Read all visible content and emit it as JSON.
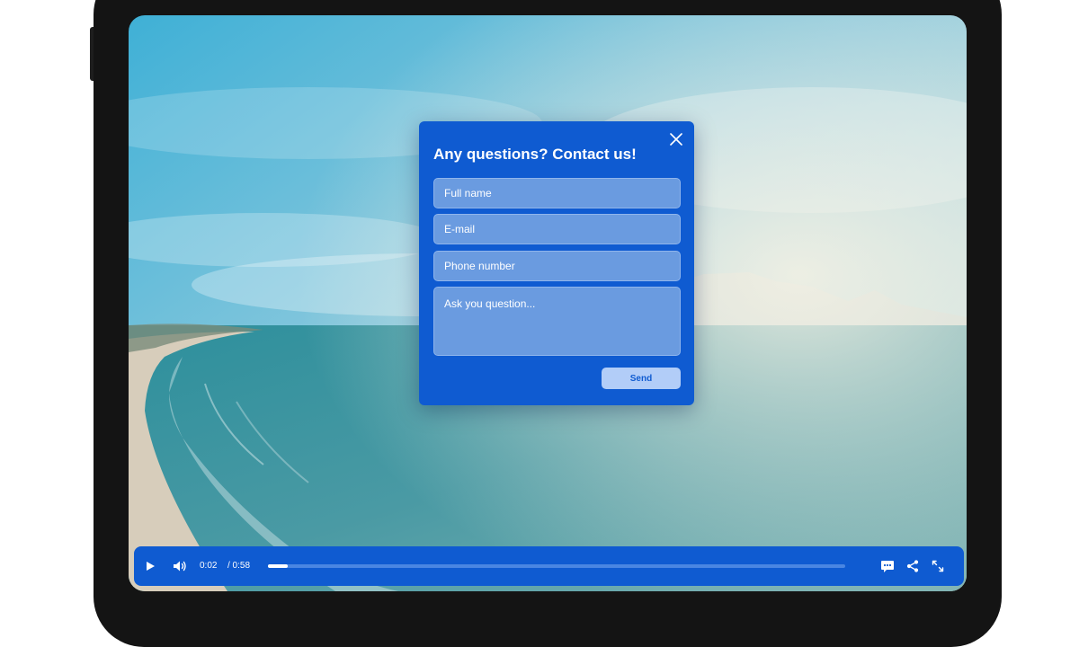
{
  "modal": {
    "title": "Any questions? Contact us!",
    "fields": {
      "full_name": {
        "placeholder": "Full name",
        "value": ""
      },
      "email": {
        "placeholder": "E-mail",
        "value": ""
      },
      "phone": {
        "placeholder": "Phone number",
        "value": ""
      },
      "question": {
        "placeholder": "Ask you question...",
        "value": ""
      }
    },
    "send_label": "Send"
  },
  "player": {
    "current_time": "0:02",
    "total_time": "/ 0:58",
    "progress_fraction": 0.034,
    "icons": [
      "play-icon",
      "volume-icon",
      "chat-icon",
      "share-icon",
      "fullscreen-icon"
    ]
  },
  "colors": {
    "accent": "#0f5bd1",
    "field_bg": "#6a9be0",
    "send_bg": "#b2cdf8",
    "progress_track": "#4a86e2"
  }
}
